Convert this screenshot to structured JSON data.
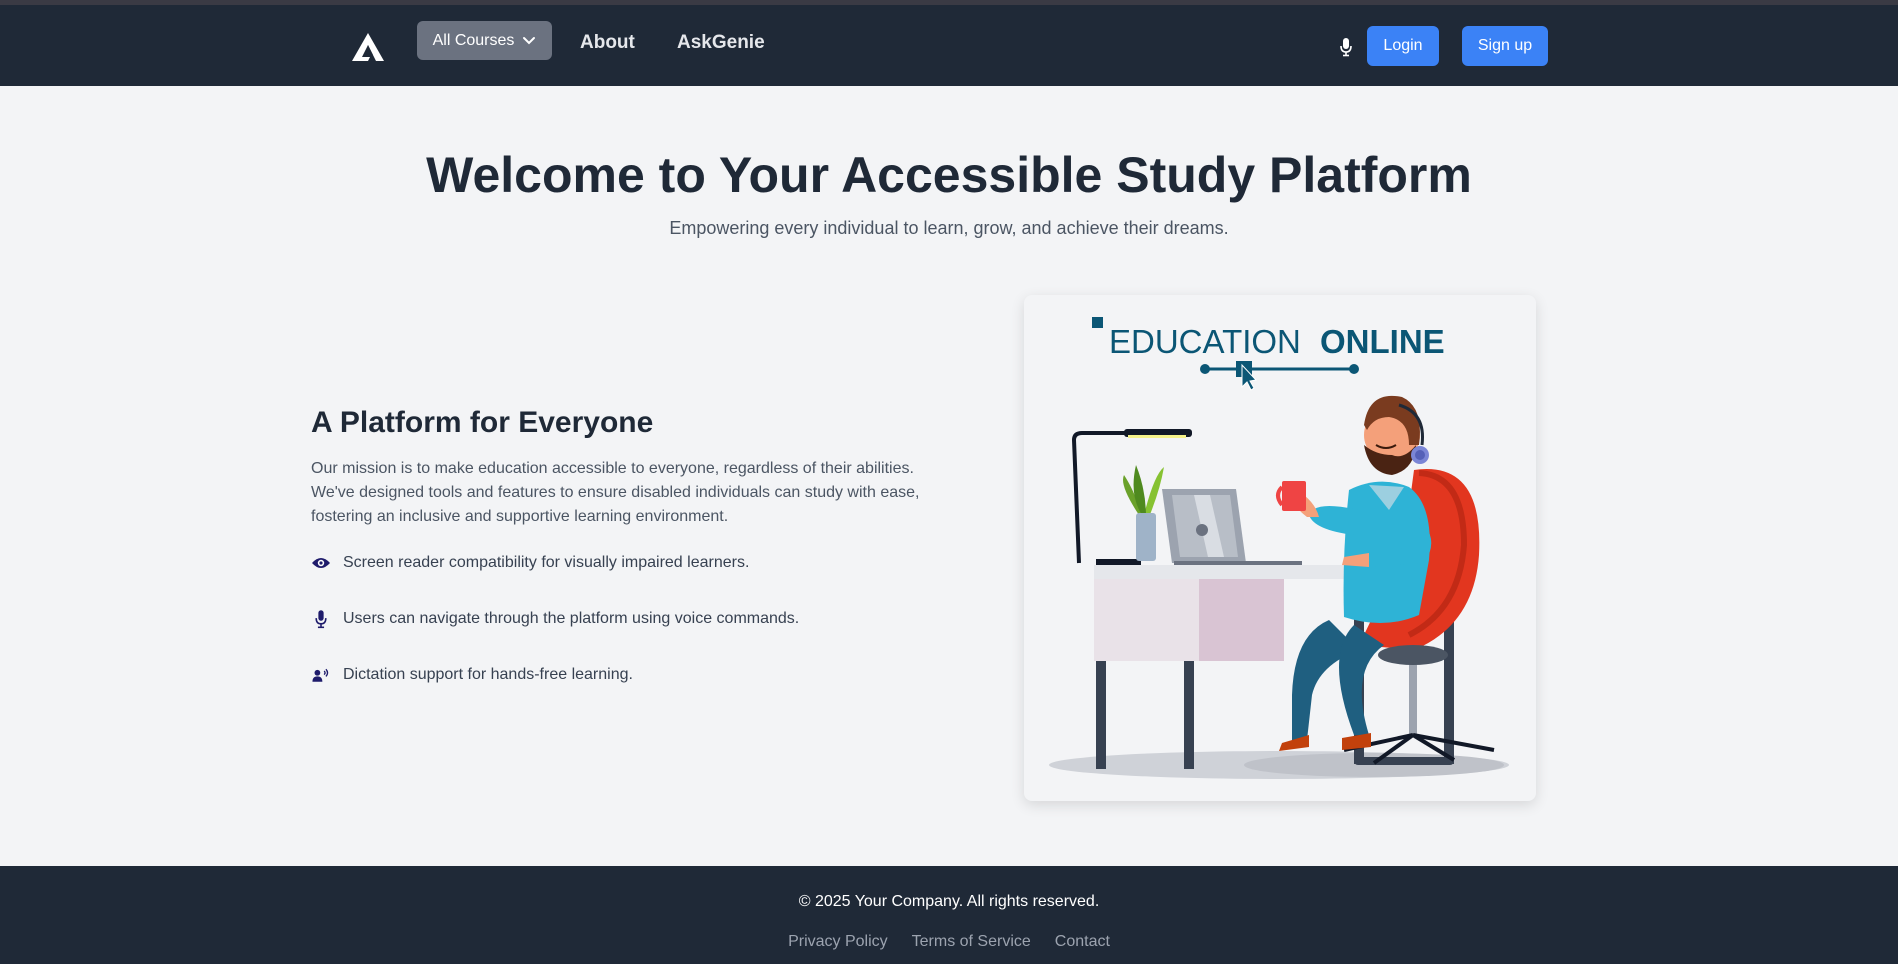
{
  "navbar": {
    "courses_label": "All Courses",
    "about_label": "About",
    "askgenie_label": "AskGenie",
    "login_label": "Login",
    "signup_label": "Sign up"
  },
  "hero": {
    "title": "Welcome to Your Accessible Study Platform",
    "subtitle": "Empowering every individual to learn, grow, and achieve their dreams."
  },
  "section": {
    "title": "A Platform for Everyone",
    "paragraph": "Our mission is to make education accessible to everyone, regardless of their abilities. We've designed tools and features to ensure disabled individuals can study with ease, fostering an inclusive and supportive learning environment.",
    "features": [
      {
        "icon": "eye-icon",
        "text": "Screen reader compatibility for visually impaired learners."
      },
      {
        "icon": "microphone-icon",
        "text": "Users can navigate through the platform using voice commands."
      },
      {
        "icon": "dictation-icon",
        "text": "Dictation support for hands-free learning."
      }
    ]
  },
  "illustration": {
    "heading_part1": "EDUCATION",
    "heading_part2": "ONLINE"
  },
  "footer": {
    "copyright": "© 2025 Your Company. All rights reserved.",
    "links": [
      "Privacy Policy",
      "Terms of Service",
      "Contact"
    ]
  },
  "colors": {
    "navbar_bg": "#1f2937",
    "accent_blue": "#3b82f6",
    "icon_navy": "#1e1b6b",
    "edu_teal": "#0b5675"
  }
}
